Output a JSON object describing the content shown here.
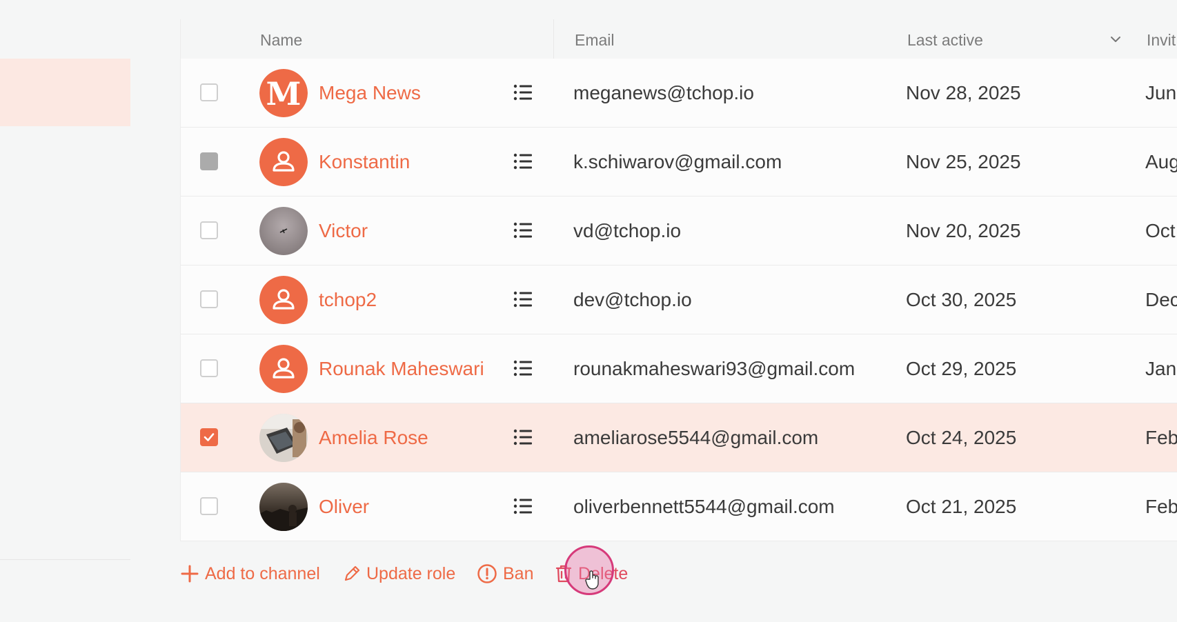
{
  "table": {
    "headers": {
      "name": "Name",
      "email": "Email",
      "last_active": "Last active",
      "invited": "Invit"
    },
    "rows": [
      {
        "name": "Mega News",
        "email": "meganews@tchop.io",
        "last_active": "Nov 28, 2025",
        "invited": "Jun",
        "checkbox": "unchecked",
        "avatar": "logo-m"
      },
      {
        "name": "Konstantin",
        "email": "k.schiwarov@gmail.com",
        "last_active": "Nov 25, 2025",
        "invited": "Aug",
        "checkbox": "indeterminate",
        "avatar": "person-icon"
      },
      {
        "name": "Victor",
        "email": "vd@tchop.io",
        "last_active": "Nov 20, 2025",
        "invited": "Oct",
        "checkbox": "unchecked",
        "avatar": "photo-sky"
      },
      {
        "name": "tchop2",
        "email": "dev@tchop.io",
        "last_active": "Oct 30, 2025",
        "invited": "Dec",
        "checkbox": "unchecked",
        "avatar": "person-icon"
      },
      {
        "name": "Rounak Maheswari",
        "email": "rounakmaheswari93@gmail.com",
        "last_active": "Oct 29, 2025",
        "invited": "Jan",
        "checkbox": "unchecked",
        "avatar": "person-icon"
      },
      {
        "name": "Amelia Rose",
        "email": "ameliarose5544@gmail.com",
        "last_active": "Oct 24, 2025",
        "invited": "Feb",
        "checkbox": "checked",
        "avatar": "photo-laptop"
      },
      {
        "name": "Oliver",
        "email": "oliverbennett5544@gmail.com",
        "last_active": "Oct 21, 2025",
        "invited": "Feb",
        "checkbox": "unchecked",
        "avatar": "photo-dark"
      }
    ]
  },
  "actions": {
    "add_to_channel": "Add to channel",
    "update_role": "Update role",
    "ban": "Ban",
    "delete": "Delete"
  },
  "colors": {
    "accent": "#ee6a46",
    "selected_row": "#fce9e3",
    "text": "#3b3b3b",
    "header_text": "#7b7b7b"
  },
  "icons": {
    "row_menu": "list-icon",
    "add": "plus-icon",
    "update": "pencil-icon",
    "ban": "alert-circle-icon",
    "delete": "trash-icon",
    "sort": "chevron-down-icon"
  }
}
